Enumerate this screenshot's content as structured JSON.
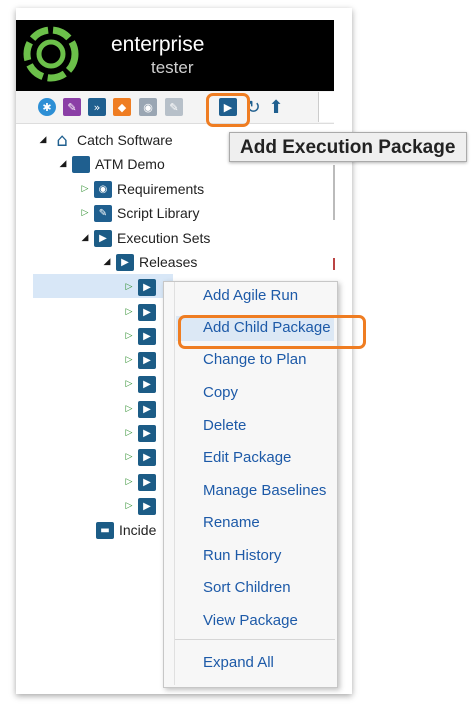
{
  "app": {
    "logo_line1": "enterprise",
    "logo_line2": "tester",
    "brand_color": "#6cc04a"
  },
  "toolbar": {
    "buttons": [
      {
        "icon": "requirement-icon",
        "color": "#2d8fd5"
      },
      {
        "icon": "script-icon",
        "color": "#8b3fa6"
      },
      {
        "icon": "fast-forward-icon",
        "color": "#1f5f8f"
      },
      {
        "icon": "bug-icon",
        "color": "#ef7d22"
      },
      {
        "icon": "camera-icon",
        "color": "#9aa6b3"
      },
      {
        "icon": "pencil-icon",
        "color": "#9aa6b3"
      },
      {
        "icon": "execution-package-icon",
        "color": "#1f5f8f"
      },
      {
        "icon": "refresh-icon",
        "color": "#1f5f8f"
      },
      {
        "icon": "upload-arrow-icon",
        "color": "#1f5f8f"
      }
    ],
    "tooltip": "Add Execution Package"
  },
  "tree": {
    "root": "Catch Software",
    "project": "ATM Demo",
    "items": [
      "Requirements",
      "Script Library",
      "Execution Sets"
    ],
    "releases": "Releases",
    "incidents_partial": "Incide"
  },
  "context_menu": {
    "items": [
      "Add Agile Run",
      "Add Child Package",
      "Change to Plan",
      "Copy",
      "Delete",
      "Edit Package",
      "Manage Baselines",
      "Rename",
      "Run History",
      "Sort Children",
      "View Package",
      "Expand All"
    ],
    "highlighted": "Add Child Package"
  },
  "colors": {
    "highlight_orange": "#ef7d22",
    "menu_text": "#1d5aa8",
    "selection": "#d8e7f7"
  }
}
